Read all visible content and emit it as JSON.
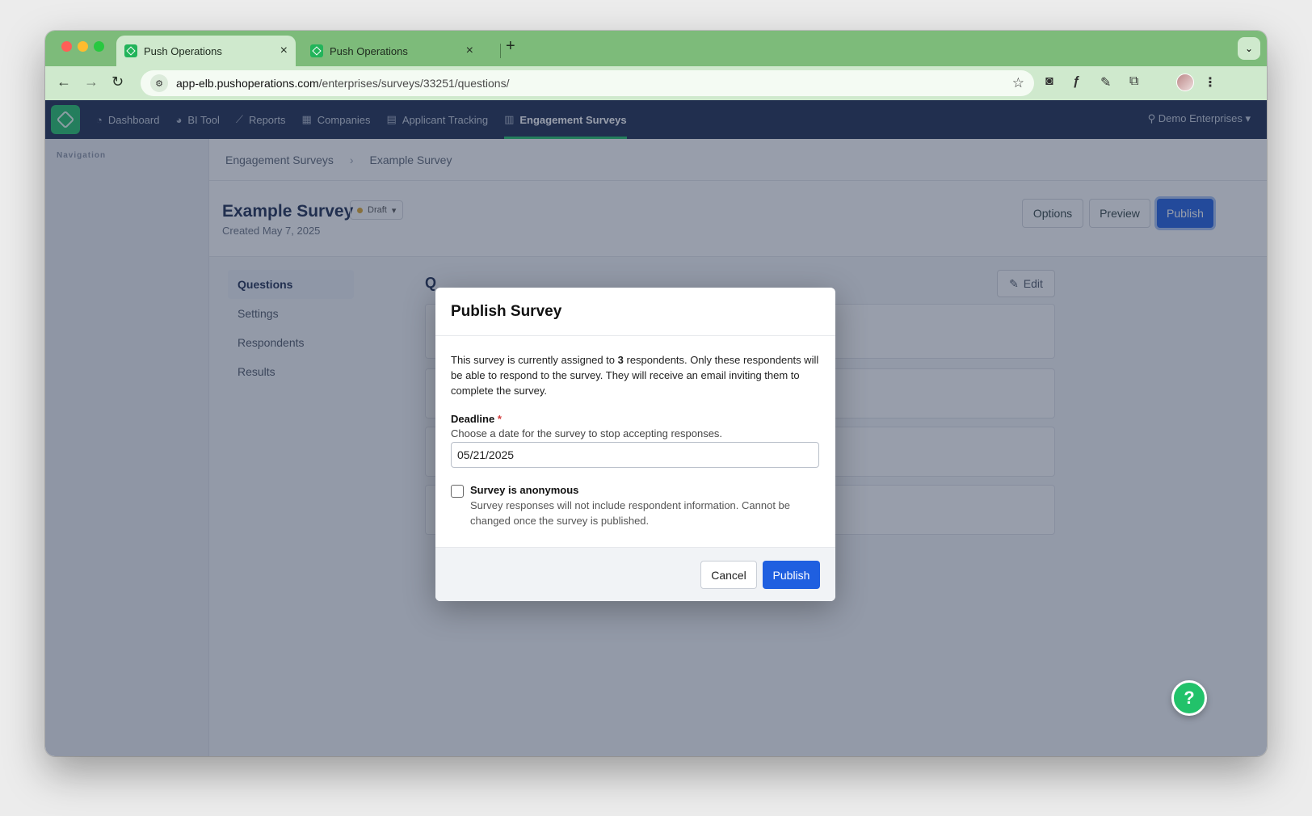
{
  "browser": {
    "tabs": [
      {
        "title": "Push Operations"
      },
      {
        "title": "Push Operations"
      }
    ],
    "new_tab_symbol": "+",
    "url_host": "app-elb.pushoperations.com",
    "url_path": "/enterprises/surveys/33251/questions/"
  },
  "topnav": {
    "items": [
      {
        "label": "Dashboard",
        "icon": "dashboard-icon"
      },
      {
        "label": "BI Tool",
        "icon": "pie-chart-icon"
      },
      {
        "label": "Reports",
        "icon": "line-chart-icon"
      },
      {
        "label": "Companies",
        "icon": "building-icon"
      },
      {
        "label": "Applicant Tracking",
        "icon": "clipboard-icon"
      },
      {
        "label": "Engagement Surveys",
        "icon": "bar-chart-icon",
        "active": true
      }
    ],
    "org_label": "Demo Enterprises"
  },
  "sidebar": {
    "title": "Navigation"
  },
  "breadcrumb": {
    "items": [
      "Engagement Surveys",
      "Example Survey"
    ]
  },
  "survey": {
    "title": "Example Survey",
    "status": "Draft",
    "created": "Created May 7, 2025",
    "actions": {
      "options": "Options",
      "preview": "Preview",
      "publish": "Publish"
    }
  },
  "subnav": {
    "items": [
      "Questions",
      "Settings",
      "Respondents",
      "Results"
    ]
  },
  "questions": {
    "heading_initial": "Q",
    "edit_label": "Edit"
  },
  "modal": {
    "title": "Publish Survey",
    "text_before": "This survey is currently assigned to ",
    "respondent_count": "3",
    "text_after": " respondents. Only these respondents will be able to respond to the survey. They will receive an email inviting them to complete the survey.",
    "deadline_label": "Deadline",
    "required_mark": "*",
    "deadline_hint": "Choose a date for the survey to stop accepting responses.",
    "deadline_value": "05/21/2025",
    "anonymous_label": "Survey is anonymous",
    "anonymous_desc": "Survey responses will not include respondent information. Cannot be changed once the survey is published.",
    "anonymous_checked": false,
    "cancel_label": "Cancel",
    "publish_label": "Publish"
  },
  "help": {
    "symbol": "?"
  },
  "colors": {
    "chrome_green": "#7dbb7a",
    "nav_navy": "#1c2b50",
    "brand_green": "#22c26a",
    "primary_blue": "#1f5fe0"
  }
}
